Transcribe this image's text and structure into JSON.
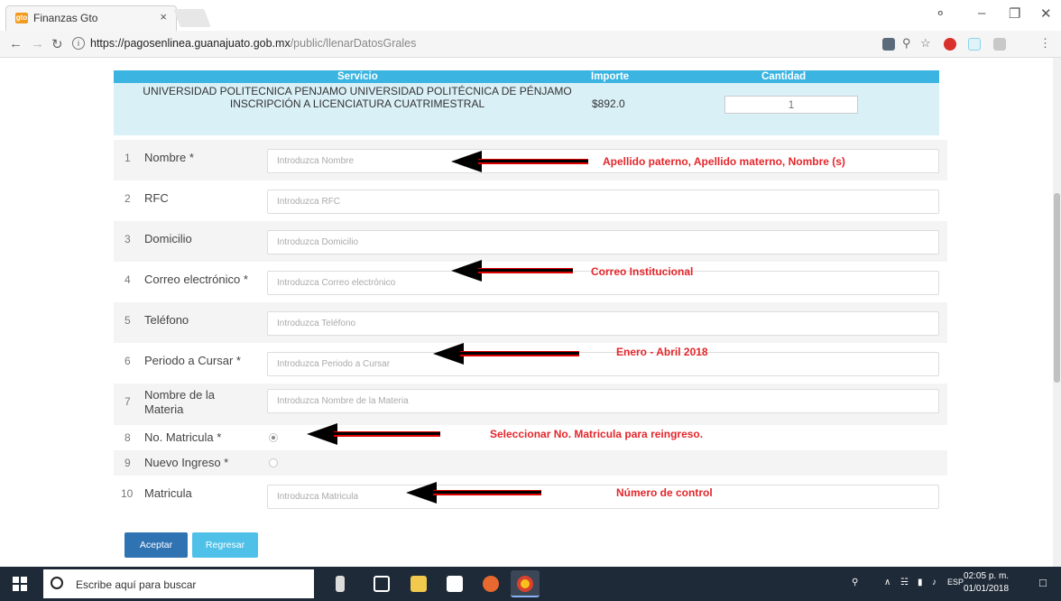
{
  "browser": {
    "tab_title": "Finanzas Gto",
    "tab_favicon_text": "gto",
    "tab_close": "×",
    "url_host": "https://pagosenlinea.guanajuato.gob.mx",
    "url_path": "/public/llenarDatosGrales"
  },
  "service_table": {
    "headers": {
      "service": "Servicio",
      "amount": "Importe",
      "quantity": "Cantidad"
    },
    "service_name": "UNIVERSIDAD POLITECNICA PENJAMO UNIVERSIDAD POLITÉCNICA DE PÉNJAMO INSCRIPCIÓN A LICENCIATURA CUATRIMESTRAL",
    "amount": "$892.0",
    "quantity": "1"
  },
  "form": {
    "rows": [
      {
        "num": "1",
        "label": "Nombre *",
        "placeholder": "Introduzca Nombre"
      },
      {
        "num": "2",
        "label": "RFC",
        "placeholder": "Introduzca RFC"
      },
      {
        "num": "3",
        "label": "Domicilio",
        "placeholder": "Introduzca Domicilio"
      },
      {
        "num": "4",
        "label": "Correo electrónico *",
        "placeholder": "Introduzca Correo electrónico"
      },
      {
        "num": "5",
        "label": "Teléfono",
        "placeholder": "Introduzca Teléfono"
      },
      {
        "num": "6",
        "label": "Periodo a Cursar *",
        "placeholder": "Introduzca Periodo a Cursar"
      },
      {
        "num": "7",
        "label": "Nombre de la Materia",
        "placeholder": "Introduzca Nombre de la Materia"
      },
      {
        "num": "8",
        "label": "No. Matricula *",
        "selected": true
      },
      {
        "num": "9",
        "label": "Nuevo Ingreso *",
        "selected": false
      },
      {
        "num": "10",
        "label": "Matricula",
        "placeholder": "Introduzca Matricula"
      }
    ],
    "accept_label": "Aceptar",
    "back_label": "Regresar"
  },
  "annotations": {
    "nombre": "Apellido paterno, Apellido materno, Nombre (s)",
    "correo": "Correo Institucional",
    "periodo": "Enero - Abril 2018",
    "matricula_radio": "Seleccionar No. Matricula para reingreso.",
    "matricula": "Número de control"
  },
  "taskbar": {
    "search_placeholder": "Escribe aquí para buscar",
    "language": "ESP",
    "time": "02:05 p. m.",
    "date": "01/01/2018"
  }
}
